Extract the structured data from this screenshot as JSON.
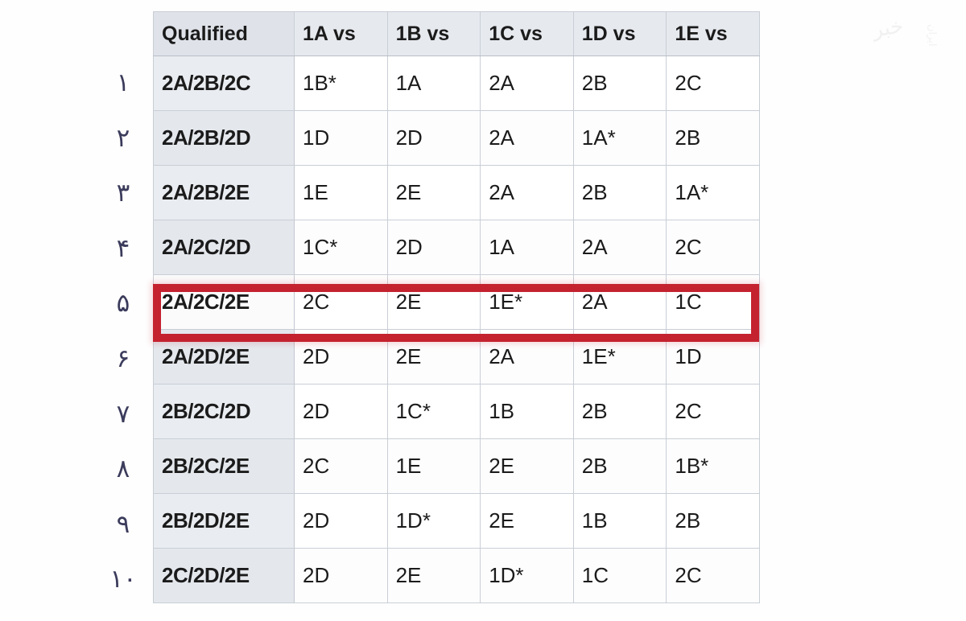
{
  "table": {
    "headers": [
      "Qualified",
      "1A vs",
      "1B vs",
      "1C vs",
      "1D vs",
      "1E vs"
    ],
    "rows": [
      {
        "qualified": "2A/2B/2C",
        "cells": [
          "1B*",
          "1A",
          "2A",
          "2B",
          "2C"
        ],
        "highlighted": false
      },
      {
        "qualified": "2A/2B/2D",
        "cells": [
          "1D",
          "2D",
          "2A",
          "1A*",
          "2B"
        ],
        "highlighted": false
      },
      {
        "qualified": "2A/2B/2E",
        "cells": [
          "1E",
          "2E",
          "2A",
          "2B",
          "1A*"
        ],
        "highlighted": false
      },
      {
        "qualified": "2A/2C/2D",
        "cells": [
          "1C*",
          "2D",
          "1A",
          "2A",
          "2C"
        ],
        "highlighted": false
      },
      {
        "qualified": "2A/2C/2E",
        "cells": [
          "2C",
          "2E",
          "1E*",
          "2A",
          "1C"
        ],
        "highlighted": true
      },
      {
        "qualified": "2A/2D/2E",
        "cells": [
          "2D",
          "2E",
          "2A",
          "1E*",
          "1D"
        ],
        "highlighted": false
      },
      {
        "qualified": "2B/2C/2D",
        "cells": [
          "2D",
          "1C*",
          "1B",
          "2B",
          "2C"
        ],
        "highlighted": false
      },
      {
        "qualified": "2B/2C/2E",
        "cells": [
          "2C",
          "1E",
          "2E",
          "2B",
          "1B*"
        ],
        "highlighted": false
      },
      {
        "qualified": "2B/2D/2E",
        "cells": [
          "2D",
          "1D*",
          "2E",
          "1B",
          "2B"
        ],
        "highlighted": false
      },
      {
        "qualified": "2C/2D/2E",
        "cells": [
          "2D",
          "2E",
          "1D*",
          "1C",
          "2C"
        ],
        "highlighted": false
      }
    ]
  },
  "row_index_numerals": [
    "۱",
    "۲",
    "۳",
    "۴",
    "۵",
    "۶",
    "۷",
    "۸",
    "۹",
    "۱۰"
  ],
  "watermark": {
    "logo": "خبر",
    "text": "ایران",
    "corner": "۱"
  },
  "colors": {
    "highlight_border": "#c4222f",
    "header_bg": "#e6e9ee",
    "qualified_bg": "#e9ecf0",
    "grid_line": "#c9ced6",
    "numeral_color": "#3b3b5c"
  }
}
